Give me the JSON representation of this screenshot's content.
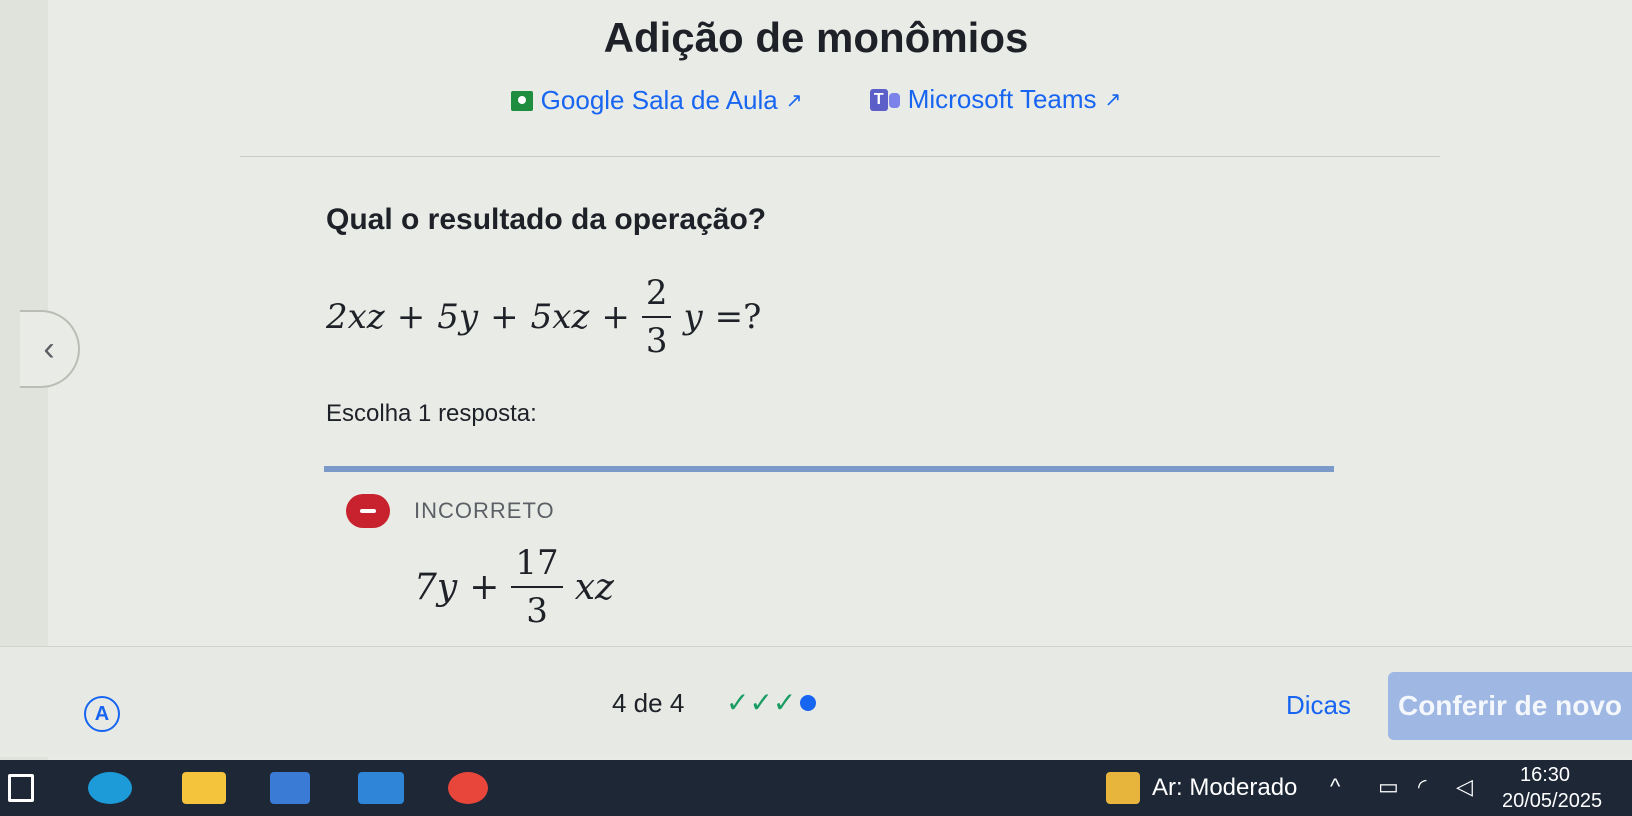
{
  "header": {
    "title": "Adição de monômios",
    "links": [
      {
        "label": "Google Sala de Aula",
        "icon": "google-classroom-icon"
      },
      {
        "label": "Microsoft Teams",
        "icon": "microsoft-teams-icon"
      }
    ],
    "external_glyph": "↗"
  },
  "question": {
    "prompt": "Qual o resultado da operação?",
    "expression": {
      "t1": "2xz",
      "op1": "+",
      "t2": "5y",
      "op2": "+",
      "t3": "5xz",
      "op3": "+",
      "frac_num": "2",
      "frac_den": "3",
      "frac_var": "y",
      "eq": "=?"
    },
    "instruction": "Escolha 1 resposta:"
  },
  "result": {
    "status": "INCORRETO",
    "answer": {
      "t1": "7y",
      "op": "+",
      "frac_num": "17",
      "frac_den": "3",
      "frac_var": "xz"
    }
  },
  "nav": {
    "prev_glyph": "‹"
  },
  "footer": {
    "accessibility_glyph": "A",
    "progress": "4 de 4",
    "progress_marks": "✓✓✓",
    "hints_label": "Dicas",
    "check_label": "Conferir de novo"
  },
  "taskbar": {
    "air_quality": "Ar: Moderado",
    "time": "16:30",
    "date": "20/05/2025"
  },
  "colors": {
    "link": "#1865f2",
    "incorrect": "#c8222e",
    "correct": "#1a9d63",
    "check_button": "#9fb7e3"
  }
}
